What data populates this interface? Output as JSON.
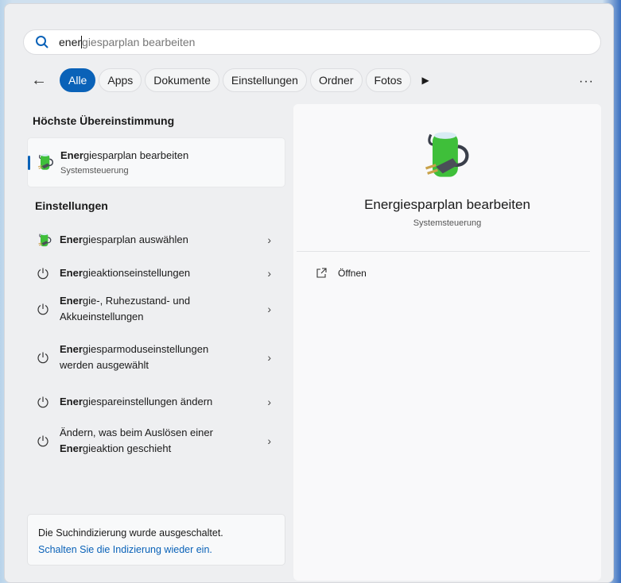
{
  "search": {
    "typed": "ener",
    "suggestion": "giesparplan bearbeiten"
  },
  "filters": [
    "Alle",
    "Apps",
    "Dokumente",
    "Einstellungen",
    "Ordner",
    "Fotos"
  ],
  "best_match": {
    "heading": "Höchste Übereinstimmung",
    "title_bold": "Ener",
    "title_rest": "giesparplan bearbeiten",
    "subtitle": "Systemsteuerung",
    "icon": "battery-plug-icon"
  },
  "settings": {
    "heading": "Einstellungen",
    "items": [
      {
        "icon": "battery-plug-icon",
        "pre": "",
        "bold": "Ener",
        "rest": "giesparplan auswählen"
      },
      {
        "icon": "power-icon",
        "pre": "",
        "bold": "Ener",
        "rest": "gieaktionseinstellungen"
      },
      {
        "icon": "power-icon",
        "pre": "",
        "bold": "Ener",
        "rest": "gie-, Ruhezustand- und Akkueinstellungen"
      },
      {
        "icon": "power-icon",
        "pre": "",
        "bold": "Ener",
        "rest": "giesparmoduseinstellungen werden ausgewählt"
      },
      {
        "icon": "power-icon",
        "pre": "",
        "bold": "Ener",
        "rest": "giespareinstellungen ändern"
      },
      {
        "icon": "power-icon",
        "pre": "Ändern, was beim Auslösen einer ",
        "bold": "Ener",
        "rest": "gieaktion geschieht"
      }
    ]
  },
  "preview": {
    "title": "Energiesparplan bearbeiten",
    "subtitle": "Systemsteuerung",
    "open_label": "Öffnen"
  },
  "footer": {
    "text": "Die Suchindizierung wurde ausgeschaltet.",
    "link": "Schalten Sie die Indizierung wieder ein."
  }
}
